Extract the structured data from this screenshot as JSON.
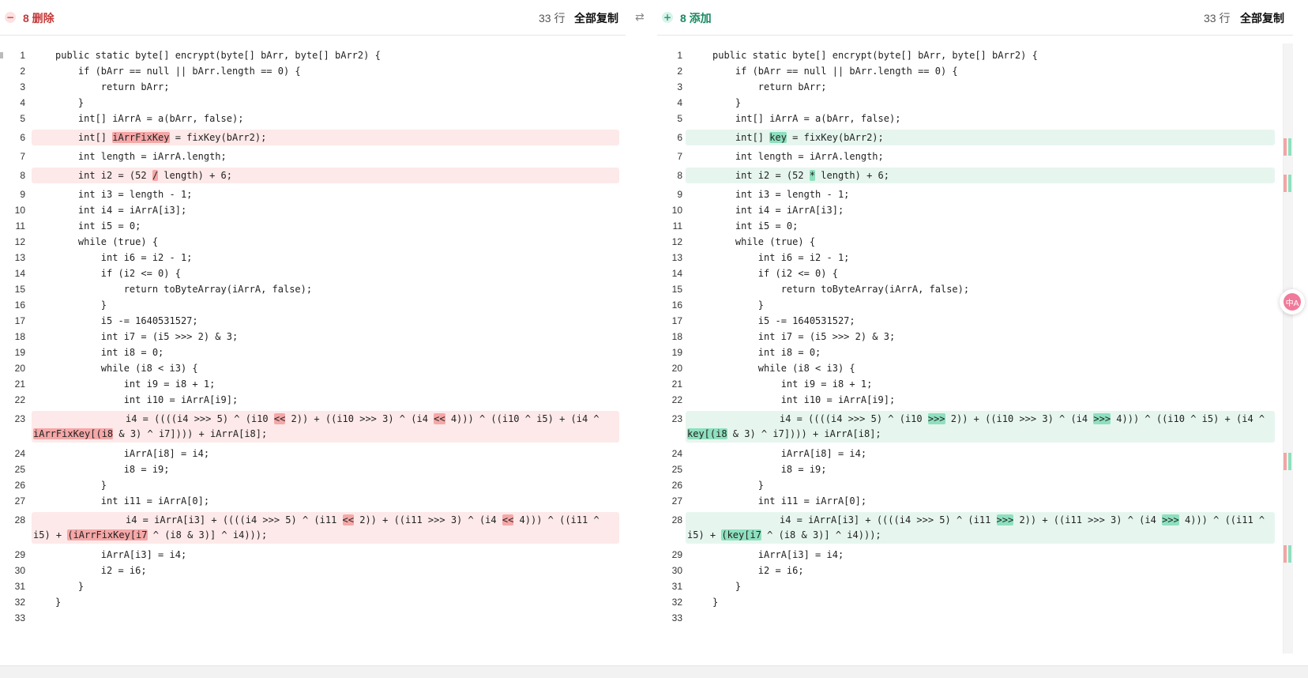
{
  "left": {
    "label": "8 删除",
    "lines": "33 行",
    "copy": "全部复制",
    "icon": "minus-icon"
  },
  "right": {
    "label": "8 添加",
    "lines": "33 行",
    "copy": "全部复制",
    "icon": "plus-icon"
  },
  "swap_icon": "swap-icon",
  "float_icon": "translate-icon",
  "colors": {
    "removed_bg": "#fde9e9",
    "removed_word": "#f5a7a7",
    "added_bg": "#e6f6ef",
    "added_word": "#8ee0bf"
  },
  "left_code": [
    {
      "n": "1",
      "t": "public static byte[] encrypt(byte[] bArr, byte[] bArr2) {"
    },
    {
      "n": "2",
      "t": "    if (bArr == null || bArr.length == 0) {"
    },
    {
      "n": "3",
      "t": "        return bArr;"
    },
    {
      "n": "4",
      "t": "    }"
    },
    {
      "n": "5",
      "t": "    int[] iArrA = a(bArr, false);"
    },
    {
      "n": "6",
      "hl": true,
      "parts": [
        {
          "t": "    int[] "
        },
        {
          "t": "iArrFixKey",
          "w": true
        },
        {
          "t": " = fixKey(bArr2);"
        }
      ]
    },
    {
      "n": "7",
      "t": "    int length = iArrA.length;"
    },
    {
      "n": "8",
      "hl": true,
      "parts": [
        {
          "t": "    int i2 = (52 "
        },
        {
          "t": "/",
          "w": true
        },
        {
          "t": " length) + 6;"
        }
      ]
    },
    {
      "n": "9",
      "t": "    int i3 = length - 1;"
    },
    {
      "n": "10",
      "t": "    int i4 = iArrA[i3];"
    },
    {
      "n": "11",
      "t": "    int i5 = 0;"
    },
    {
      "n": "12",
      "t": "    while (true) {"
    },
    {
      "n": "13",
      "t": "        int i6 = i2 - 1;"
    },
    {
      "n": "14",
      "t": "        if (i2 <= 0) {"
    },
    {
      "n": "15",
      "t": "            return toByteArray(iArrA, false);"
    },
    {
      "n": "16",
      "t": "        }"
    },
    {
      "n": "17",
      "t": "        i5 -= 1640531527;"
    },
    {
      "n": "18",
      "t": "        int i7 = (i5 >>> 2) & 3;"
    },
    {
      "n": "19",
      "t": "        int i8 = 0;"
    },
    {
      "n": "20",
      "t": "        while (i8 < i3) {"
    },
    {
      "n": "21",
      "t": "            int i9 = i8 + 1;"
    },
    {
      "n": "22",
      "t": "            int i10 = iArrA[i9];"
    },
    {
      "n": "23",
      "hl": true,
      "tall": true,
      "parts": [
        {
          "t": "i4 = ((((i4 >>> 5) ^ (i10 "
        },
        {
          "t": "<<",
          "w": true
        },
        {
          "t": " 2)) + ((i10 >>> 3) ^ (i4 "
        },
        {
          "t": "<<",
          "w": true
        },
        {
          "t": " 4))) ^ ((i10 ^ i5) + (i4 ^ "
        },
        {
          "t": "iArrFixKey[(i8",
          "w": true
        },
        {
          "t": " & 3) ^ i7]))) + iArrA[i8];"
        }
      ]
    },
    {
      "n": "24",
      "t": "            iArrA[i8] = i4;"
    },
    {
      "n": "25",
      "t": "            i8 = i9;"
    },
    {
      "n": "26",
      "t": "        }"
    },
    {
      "n": "27",
      "t": "        int i11 = iArrA[0];"
    },
    {
      "n": "28",
      "hl": true,
      "tall": true,
      "parts": [
        {
          "t": "i4 = iArrA[i3] + ((((i4 >>> 5) ^ (i11 "
        },
        {
          "t": "<<",
          "w": true
        },
        {
          "t": " 2)) + ((i11 >>> 3) ^ (i4 "
        },
        {
          "t": "<<",
          "w": true
        },
        {
          "t": " 4))) ^ ((i11 ^ i5) + "
        },
        {
          "t": "(iArrFixKey[i7",
          "w": true
        },
        {
          "t": " ^ (i8 & 3)] ^ i4)));"
        }
      ]
    },
    {
      "n": "29",
      "t": "        iArrA[i3] = i4;"
    },
    {
      "n": "30",
      "t": "        i2 = i6;"
    },
    {
      "n": "31",
      "t": "    }"
    },
    {
      "n": "32",
      "t": "}"
    },
    {
      "n": "33",
      "t": ""
    }
  ],
  "right_code": [
    {
      "n": "1",
      "t": "public static byte[] encrypt(byte[] bArr, byte[] bArr2) {"
    },
    {
      "n": "2",
      "t": "    if (bArr == null || bArr.length == 0) {"
    },
    {
      "n": "3",
      "t": "        return bArr;"
    },
    {
      "n": "4",
      "t": "    }"
    },
    {
      "n": "5",
      "t": "    int[] iArrA = a(bArr, false);"
    },
    {
      "n": "6",
      "hl": true,
      "parts": [
        {
          "t": "    int[] "
        },
        {
          "t": "key",
          "w": true
        },
        {
          "t": " = fixKey(bArr2);"
        }
      ]
    },
    {
      "n": "7",
      "t": "    int length = iArrA.length;"
    },
    {
      "n": "8",
      "hl": true,
      "parts": [
        {
          "t": "    int i2 = (52 "
        },
        {
          "t": "*",
          "w": true
        },
        {
          "t": " length) + 6;"
        }
      ]
    },
    {
      "n": "9",
      "t": "    int i3 = length - 1;"
    },
    {
      "n": "10",
      "t": "    int i4 = iArrA[i3];"
    },
    {
      "n": "11",
      "t": "    int i5 = 0;"
    },
    {
      "n": "12",
      "t": "    while (true) {"
    },
    {
      "n": "13",
      "t": "        int i6 = i2 - 1;"
    },
    {
      "n": "14",
      "t": "        if (i2 <= 0) {"
    },
    {
      "n": "15",
      "t": "            return toByteArray(iArrA, false);"
    },
    {
      "n": "16",
      "t": "        }"
    },
    {
      "n": "17",
      "t": "        i5 -= 1640531527;"
    },
    {
      "n": "18",
      "t": "        int i7 = (i5 >>> 2) & 3;"
    },
    {
      "n": "19",
      "t": "        int i8 = 0;"
    },
    {
      "n": "20",
      "t": "        while (i8 < i3) {"
    },
    {
      "n": "21",
      "t": "            int i9 = i8 + 1;"
    },
    {
      "n": "22",
      "t": "            int i10 = iArrA[i9];"
    },
    {
      "n": "23",
      "hl": true,
      "tall": true,
      "parts": [
        {
          "t": "i4 = ((((i4 >>> 5) ^ (i10 "
        },
        {
          "t": ">>>",
          "w": true
        },
        {
          "t": " 2)) + ((i10 >>> 3) ^ (i4 "
        },
        {
          "t": ">>>",
          "w": true
        },
        {
          "t": " 4))) ^ ((i10 ^ i5) + (i4 ^ "
        },
        {
          "t": "key[(i8",
          "w": true
        },
        {
          "t": " & 3) ^ i7]))) + iArrA[i8];"
        }
      ]
    },
    {
      "n": "24",
      "t": "            iArrA[i8] = i4;"
    },
    {
      "n": "25",
      "t": "            i8 = i9;"
    },
    {
      "n": "26",
      "t": "        }"
    },
    {
      "n": "27",
      "t": "        int i11 = iArrA[0];"
    },
    {
      "n": "28",
      "hl": true,
      "tall": true,
      "parts": [
        {
          "t": "i4 = iArrA[i3] + ((((i4 >>> 5) ^ (i11 "
        },
        {
          "t": ">>>",
          "w": true
        },
        {
          "t": " 2)) + ((i11 >>> 3) ^ (i4 "
        },
        {
          "t": ">>>",
          "w": true
        },
        {
          "t": " 4))) ^ ((i11 ^ i5) + "
        },
        {
          "t": "(key[i7",
          "w": true
        },
        {
          "t": " ^ (i8 & 3)] ^ i4)));"
        }
      ]
    },
    {
      "n": "29",
      "t": "        iArrA[i3] = i4;"
    },
    {
      "n": "30",
      "t": "        i2 = i6;"
    },
    {
      "n": "31",
      "t": "    }"
    },
    {
      "n": "32",
      "t": "}"
    },
    {
      "n": "33",
      "t": ""
    }
  ]
}
